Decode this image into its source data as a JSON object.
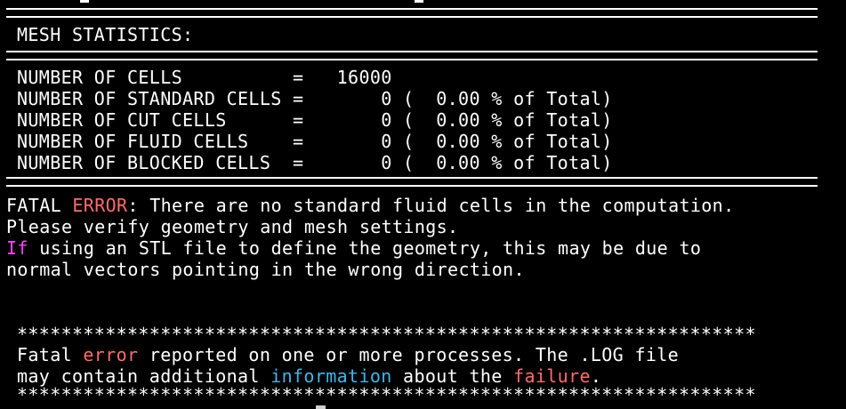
{
  "colors": {
    "background": "#000000",
    "text": "#ffffff",
    "error_red": "#ff6b6b",
    "keyword_magenta": "#ff44ff",
    "info_cyan": "#3fb6e8"
  },
  "stats": {
    "heading": "MESH STATISTICS:",
    "rows": [
      {
        "label": "NUMBER OF CELLS          =",
        "value": "   16000",
        "pct": ""
      },
      {
        "label": "NUMBER OF STANDARD CELLS =",
        "value": "       0 ( ",
        "pct": " 0.00 % of Total)"
      },
      {
        "label": "NUMBER OF CUT CELLS      =",
        "value": "       0 ( ",
        "pct": " 0.00 % of Total)"
      },
      {
        "label": "NUMBER OF FLUID CELLS    =",
        "value": "       0 ( ",
        "pct": " 0.00 % of Total)"
      },
      {
        "label": "NUMBER OF BLOCKED CELLS  =",
        "value": "       0 ( ",
        "pct": " 0.00 % of Total)"
      }
    ]
  },
  "fatal": {
    "prefix": "FATAL ",
    "error_word": "ERROR",
    "line1_rest": ": There are no standard fluid cells in the computation.",
    "line2": "Please verify geometry and mesh settings.",
    "if_word": "If",
    "line3_rest": " using an STL file to define the geometry, this may be due to",
    "line4": "normal vectors pointing in the wrong direction."
  },
  "footer": {
    "stars": "*******************************************************************",
    "l1_a": "Fatal ",
    "l1_error": "error",
    "l1_b": " reported on one or more processes. The .LOG file",
    "l2_a": "may contain additional ",
    "l2_info": "information",
    "l2_b": " about the ",
    "l2_failure": "failure",
    "l2_c": "."
  }
}
